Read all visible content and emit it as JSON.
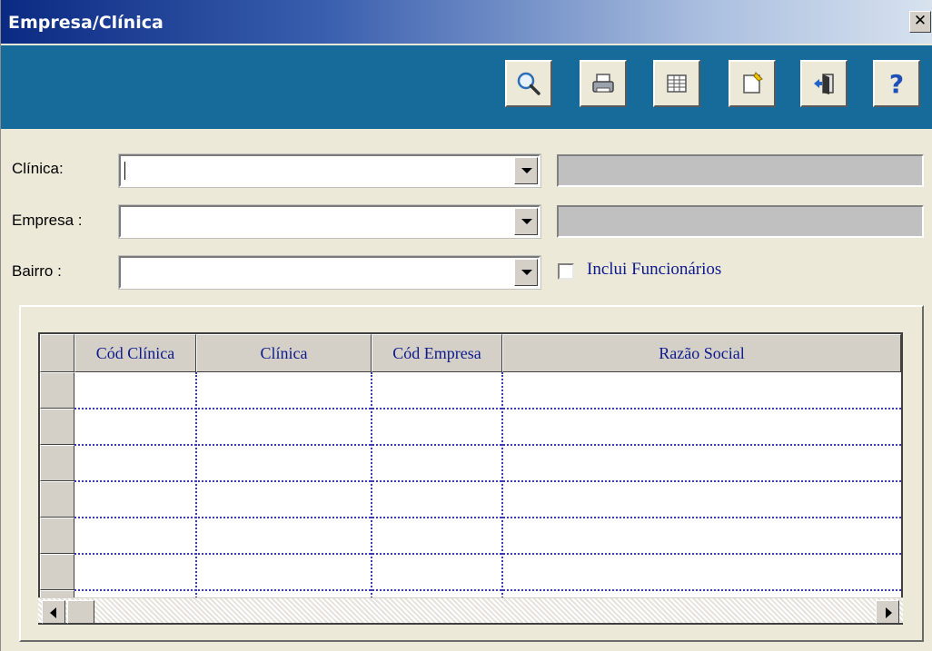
{
  "window": {
    "title": "Empresa/Clínica",
    "close_glyph": "✕"
  },
  "toolbar": {
    "buttons": [
      {
        "id": "search",
        "icon": "magnifier-icon"
      },
      {
        "id": "print",
        "icon": "printer-icon"
      },
      {
        "id": "grid",
        "icon": "table-icon"
      },
      {
        "id": "edit",
        "icon": "note-edit-icon"
      },
      {
        "id": "exit",
        "icon": "exit-door-icon"
      },
      {
        "id": "help",
        "icon": "help-icon",
        "glyph": "?"
      }
    ],
    "band_color": "#166b9a"
  },
  "form": {
    "clinica": {
      "label": "Clínica:",
      "value": ""
    },
    "empresa": {
      "label": "Empresa :",
      "value": ""
    },
    "bairro": {
      "label": "Bairro :",
      "value": ""
    },
    "inclui_funcionarios": {
      "label": "Inclui Funcionários",
      "checked": false
    }
  },
  "grid": {
    "columns": [
      "Cód Clínica",
      "Clínica",
      "Cód Empresa",
      "Razão Social"
    ],
    "rows": []
  },
  "colors": {
    "accent_text": "#0d1a8c",
    "window_bg": "#ece9d8",
    "title_start": "#0b2a83"
  }
}
